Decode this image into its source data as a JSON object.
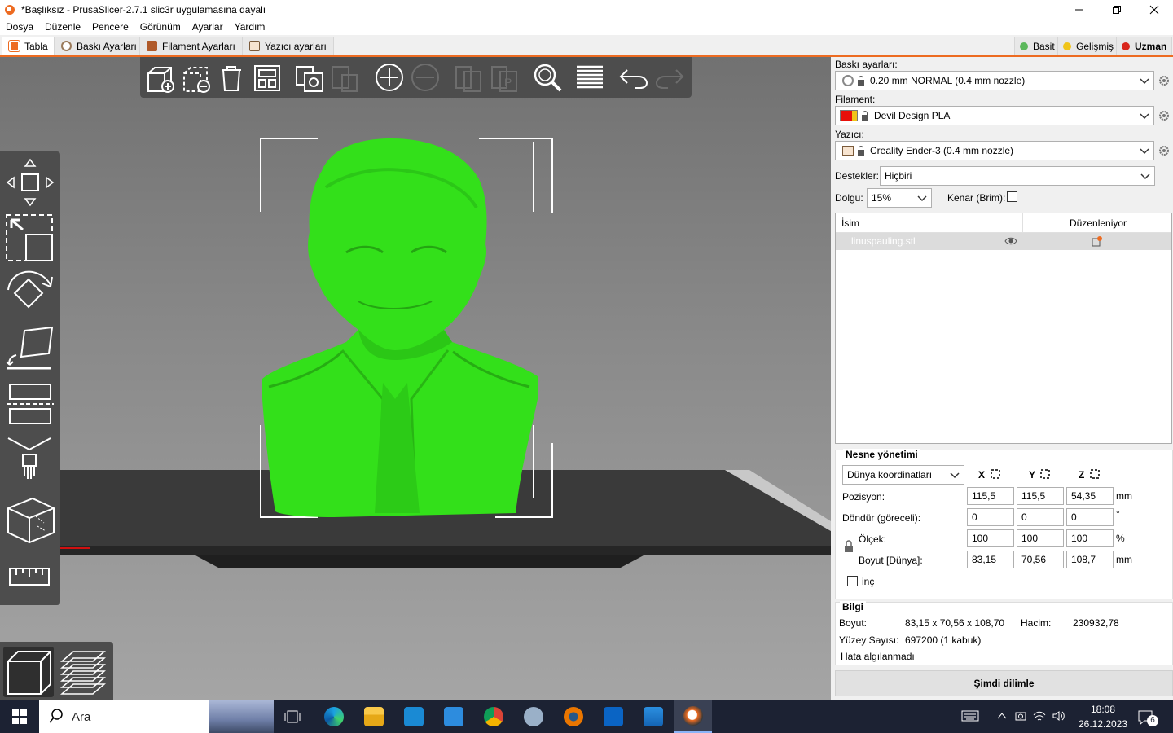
{
  "window": {
    "title": "*Başlıksız - PrusaSlicer-2.7.1 slic3r uygulamasına dayalı",
    "controls": [
      "minimize-icon",
      "maximize-icon",
      "close-icon"
    ]
  },
  "menu": [
    "Dosya",
    "Düzenle",
    "Pencere",
    "Görünüm",
    "Ayarlar",
    "Yardım"
  ],
  "tabs": [
    {
      "label": "Tabla",
      "icon": "plater-icon",
      "active": true
    },
    {
      "label": "Baskı Ayarları",
      "icon": "cog-icon",
      "active": false
    },
    {
      "label": "Filament Ayarları",
      "icon": "spool-icon",
      "active": false
    },
    {
      "label": "Yazıcı ayarları",
      "icon": "printer-icon",
      "active": false
    }
  ],
  "modes": [
    {
      "label": "Basit",
      "color": "#5cb85c",
      "active": false
    },
    {
      "label": "Gelişmiş",
      "color": "#f0c419",
      "active": false
    },
    {
      "label": "Uzman",
      "color": "#d9261c",
      "active": true
    }
  ],
  "toolbar_top": [
    "add-icon",
    "delete-icon",
    "delete-all-icon",
    "arrange-icon",
    "copy-icon",
    "paste-icon",
    "add-instance-icon",
    "remove-instance-icon",
    "split-objects-icon",
    "split-parts-icon",
    "search-icon",
    "layers-editing-icon",
    "undo-icon",
    "redo-icon"
  ],
  "toolbar_left": [
    "move-icon",
    "scale-icon",
    "rotate-icon",
    "place-on-face-icon",
    "cut-icon",
    "paint-supports-icon",
    "seam-painting-icon",
    "measure-icon"
  ],
  "view_tabs": [
    {
      "icon": "3d-view-icon",
      "active": true
    },
    {
      "icon": "preview-icon",
      "active": false
    }
  ],
  "print_settings": {
    "label": "Baskı ayarları:",
    "value": "0.20 mm NORMAL (0.4 mm nozzle)"
  },
  "filament": {
    "label": "Filament:",
    "value": "Devil Design PLA",
    "color": "#e8100a"
  },
  "printer": {
    "label": "Yazıcı:",
    "value": "Creality Ender-3 (0.4 mm nozzle)"
  },
  "supports": {
    "label": "Destekler:",
    "value": "Hiçbiri"
  },
  "infill": {
    "label": "Dolgu:",
    "value": "15%"
  },
  "brim": {
    "label": "Kenar (Brim):",
    "checked": false
  },
  "object_list": {
    "headers": {
      "name": "İsim",
      "editing": "Düzenleniyor"
    },
    "rows": [
      {
        "name": "linuspauling.stl"
      }
    ]
  },
  "object_manipulation": {
    "title": "Nesne yönetimi",
    "coordinates": "Dünya koordinatları",
    "axes": [
      "X",
      "Y",
      "Z"
    ],
    "position": {
      "label": "Pozisyon:",
      "values": [
        "115,5",
        "115,5",
        "54,35"
      ],
      "unit": "mm"
    },
    "rotation": {
      "label": "Döndür (göreceli):",
      "values": [
        "0",
        "0",
        "0"
      ],
      "unit": "°"
    },
    "scale": {
      "label": "Ölçek:",
      "values": [
        "100",
        "100",
        "100"
      ],
      "unit": "%"
    },
    "size": {
      "label": "Boyut [Dünya]:",
      "values": [
        "83,15",
        "70,56",
        "108,7"
      ],
      "unit": "mm"
    },
    "inches": {
      "label": "inç",
      "checked": false
    }
  },
  "info": {
    "title": "Bilgi",
    "size_label": "Boyut:",
    "size_value": "83,15 x 70,56 x 108,70",
    "volume_label": "Hacim:",
    "volume_value": "230932,78",
    "facets_label": "Yüzey Sayısı:",
    "facets_value": "697200 (1 kabuk)",
    "errors": "Hata algılanmadı"
  },
  "slice_button": "Şimdi dilimle",
  "taskbar": {
    "search_placeholder": "Ara",
    "apps": [
      "task-view-icon",
      "edge-icon",
      "file-explorer-icon",
      "store-icon",
      "mail-icon",
      "chrome-icon",
      "app-icon",
      "blender-icon",
      "outlook-new-icon",
      "photos-icon",
      "prusaslicer-icon"
    ],
    "time": "18:08",
    "date": "26.12.2023",
    "notifications": "6"
  },
  "colors": {
    "accent": "#ed6b21",
    "model": "#33e01a",
    "panel_dark": "#4d4d4d"
  }
}
